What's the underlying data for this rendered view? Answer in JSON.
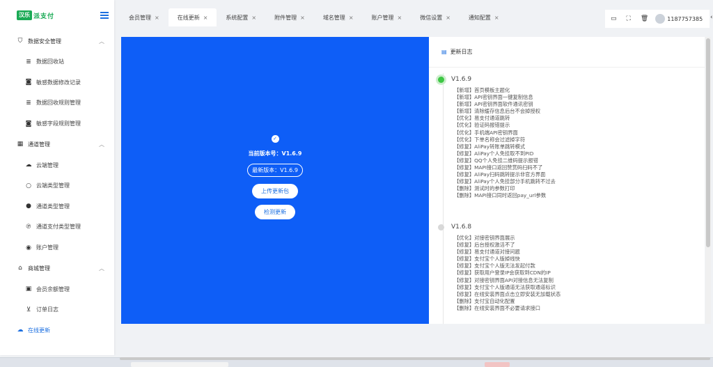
{
  "brand": {
    "badge": "汉乐",
    "text": "派支付"
  },
  "sidebar": {
    "groups": [
      {
        "label": "数据安全管理",
        "icon": "shield-icon",
        "items": [
          {
            "label": "数据回收站",
            "icon": "database-icon"
          },
          {
            "label": "敏感数据修改记录",
            "icon": "lock-icon"
          },
          {
            "label": "数据回收规则管理",
            "icon": "database-icon"
          },
          {
            "label": "敏感字段规则管理",
            "icon": "lock-icon"
          }
        ]
      },
      {
        "label": "通道管理",
        "icon": "grid-icon",
        "items": [
          {
            "label": "云端管理",
            "icon": "cloud-icon"
          },
          {
            "label": "云端类型管理",
            "icon": "cloud-outline-icon"
          },
          {
            "label": "通道类型管理",
            "icon": "circle-icon"
          },
          {
            "label": "通道支付类型管理",
            "icon": "paypal-icon"
          },
          {
            "label": "账户管理",
            "icon": "account-icon"
          }
        ]
      },
      {
        "label": "商城管理",
        "icon": "shop-icon",
        "items": [
          {
            "label": "会员余额管理",
            "icon": "id-card-icon"
          },
          {
            "label": "订单日志",
            "icon": "cart-icon"
          }
        ]
      }
    ],
    "active": {
      "label": "在线更新",
      "icon": "cloud-upload-icon"
    }
  },
  "tabs": [
    {
      "label": "会员管理",
      "active": false
    },
    {
      "label": "在线更新",
      "active": true
    },
    {
      "label": "系统配置",
      "active": false
    },
    {
      "label": "附件管理",
      "active": false
    },
    {
      "label": "域名管理",
      "active": false
    },
    {
      "label": "账户管理",
      "active": false
    },
    {
      "label": "微信设置",
      "active": false
    },
    {
      "label": "通知配置",
      "active": false
    }
  ],
  "toolbar": {
    "username": "1187757385"
  },
  "update": {
    "current": "当前版本号：V1.6.9",
    "latest": "最新版本：V1.6.9",
    "upload_button": "上传更新包",
    "check_button": "检测更新"
  },
  "changelog": {
    "title": "更新日志",
    "versions": [
      {
        "version": "V1.6.9",
        "current": true,
        "entries": [
          "【新增】首页模板主题化",
          "【新增】API密钥界面一键复制信息",
          "【新增】API密钥界面软件通讯密钥",
          "【新增】清除缓存信息后台不会掉授权",
          "【优化】易支付通道跳转",
          "【优化】验证码报错提示",
          "【优化】手机端API密钥界面",
          "【优化】下单名称会过滤掉字符",
          "【修复】AliPay转账单跳转模式",
          "【修复】AliPay个人免挂取不到PID",
          "【修复】QQ个人免挂二维码提示报错",
          "【修复】MAPI接口返回赞赏码扫码不了",
          "【修复】AliPay扫码跳转提示非官方界面",
          "【修复】AliPay个人免挂部分手机跳转不过去",
          "【删除】测试时的参数打印",
          "【删除】MAPI接口同时返回pay_url参数"
        ]
      },
      {
        "version": "V1.6.8",
        "current": false,
        "entries": [
          "【优化】对接密钥界面展示",
          "【修复】后台授权激活不了",
          "【修复】易支付通道对接问题",
          "【修复】支付宝个人版掉线快",
          "【修复】支付宝个人版无法发起付款",
          "【修复】获取用户登录IP会获取到CDN的IP",
          "【修复】对接密钥界面API对接信息无法复制",
          "【修复】支付宝个人版通道无法获取通道标识",
          "【修复】在线安装界面点击立即安装无加载状态",
          "【删除】支付宝自动化配置",
          "【删除】在线安装界面不必要请求接口"
        ]
      }
    ]
  },
  "colors": {
    "primary": "#0e5ef7",
    "accent": "#1c6fe0",
    "brand_green": "#1aaa55",
    "timeline_current": "#3ec745"
  }
}
